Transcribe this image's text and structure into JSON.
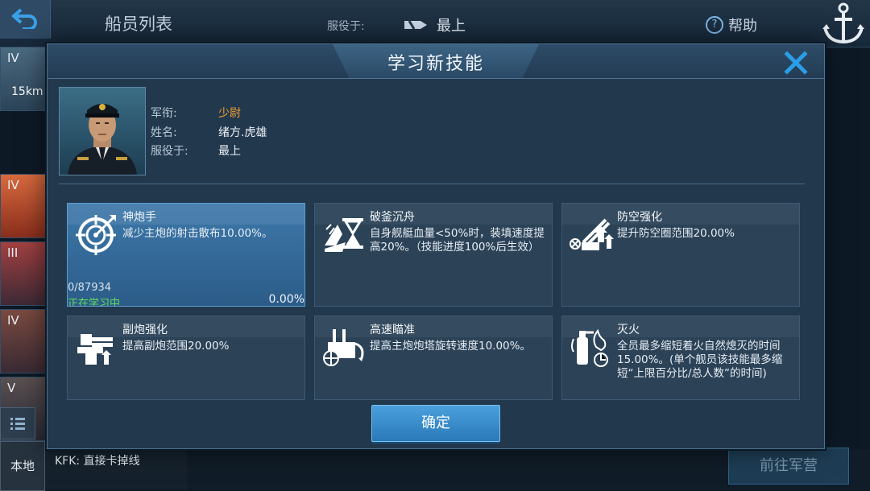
{
  "background": {
    "title": "船员列表",
    "serve_label": "服役于:",
    "serve_value": "最上",
    "help_label": "帮助",
    "speed": "15km",
    "ship_tiers": [
      "IV",
      "IV",
      "III",
      "IV",
      "V"
    ],
    "local_tab": "本地",
    "chat_text": "KFK: 直接卡掉线",
    "go_barracks": "前往军营"
  },
  "modal": {
    "title": "学习新技能",
    "officer": {
      "rank_label": "军衔:",
      "rank_value": "少尉",
      "name_label": "姓名:",
      "name_value": "绪方.虎雄",
      "serve_label": "服役于:",
      "serve_value": "最上"
    },
    "skills": [
      {
        "icon": "target-crosshair-icon",
        "name": "神炮手",
        "desc": "减少主炮的射击散布10.00%。",
        "progress": "0/87934",
        "status": "正在学习中",
        "percent": "0.00%",
        "selected": true
      },
      {
        "icon": "hourglass-ship-icon",
        "name": "破釜沉舟",
        "desc": "自身舰艇血量<50%时，装填速度提高20%。（技能进度100%后生效）"
      },
      {
        "icon": "anti-air-gun-icon",
        "name": "防空强化",
        "desc": "提升防空圈范围20.00%"
      },
      {
        "icon": "secondary-gun-icon",
        "name": "副炮强化",
        "desc": "提高副炮范围20.00%"
      },
      {
        "icon": "turret-aim-icon",
        "name": "高速瞄准",
        "desc": "提高主炮炮塔旋转速度10.00%。"
      },
      {
        "icon": "fire-extinguisher-icon",
        "name": "灭火",
        "desc": "全员最多缩短着火自然熄灭的时间15.00%。(单个舰员该技能最多缩短“上限百分比/总人数”的时间)"
      }
    ],
    "confirm_label": "确定"
  },
  "colors": {
    "rank_accent": "#f0a030",
    "status_green": "#62e05a",
    "selected_card": "#3d78aa",
    "confirm_button": "#2a78b8"
  }
}
